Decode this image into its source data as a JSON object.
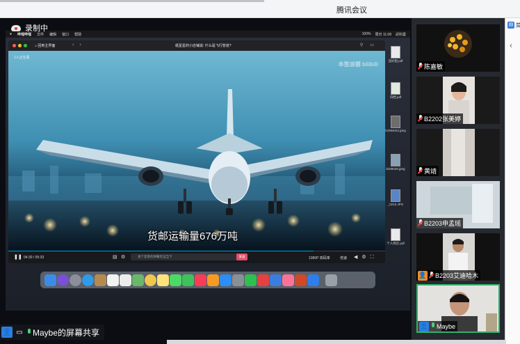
{
  "window": {
    "title": "腾讯会议"
  },
  "recording": {
    "label": "录制中"
  },
  "mac_menubar": {
    "app": "哔哩哔哩",
    "menus": [
      "文件",
      "编辑",
      "窗口",
      "帮助"
    ],
    "battery": "100%",
    "clock": "周日 11:08",
    "user": "武科曼"
  },
  "desktop_files": [
    "竞好祖.pdf",
    "归档.pdf",
    "bz094042.jpeg",
    "bz89039.jpeg",
    "_0210.JPG",
    "个人简历.pdf"
  ],
  "player": {
    "home_label": "回到主界面",
    "title": "纸星星的小店铺说: 什么是飞行管道?",
    "viewers": "1人正在看",
    "watermark": "本签派钢 bilibili",
    "subtitle": "货邮运输量676万吨",
    "time": "04:30 / 05:33",
    "danmu_placeholder": "发个友善的弹幕见证当下",
    "send_label": "发送",
    "quality": "1080P 高码率",
    "speed": "倍速",
    "progress": 0.81
  },
  "share": {
    "label": "Maybe的屏幕共享"
  },
  "participants": [
    {
      "name": "陈嘉敏",
      "mic": "off",
      "badge": ""
    },
    {
      "name": "B2202张美婷",
      "mic": "off",
      "badge": ""
    },
    {
      "name": "黄靖",
      "mic": "off",
      "badge": ""
    },
    {
      "name": "B2203申孟瑶",
      "mic": "off",
      "badge": ""
    },
    {
      "name": "B2203艾迪哈木",
      "mic": "off",
      "badge": "orange"
    },
    {
      "name": "Maybe",
      "mic": "on",
      "badge": "blue"
    }
  ],
  "side_panel": {
    "text": "简"
  }
}
